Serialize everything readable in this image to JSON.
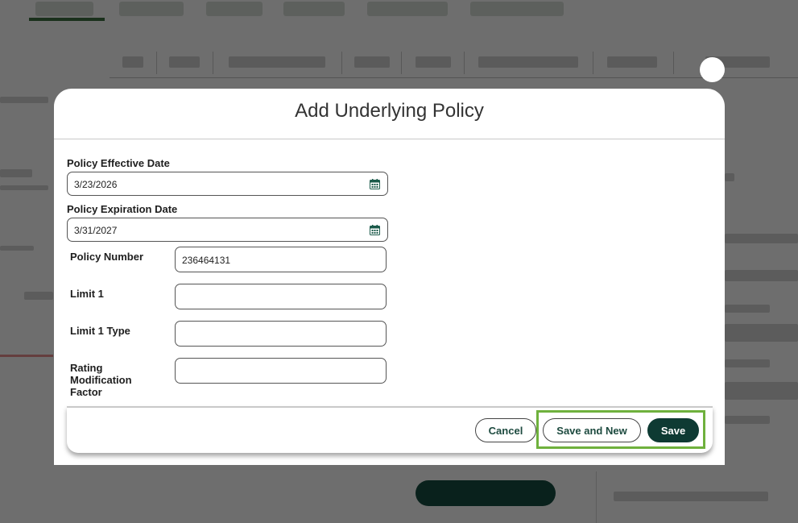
{
  "modal": {
    "title": "Add Underlying Policy",
    "fields": {
      "effective_date": {
        "label": "Policy Effective Date",
        "value": "3/23/2026"
      },
      "expiration_date": {
        "label": "Policy Expiration Date",
        "value": "3/31/2027"
      },
      "policy_number": {
        "label": "Policy Number",
        "value": "236464131"
      },
      "limit1": {
        "label": "Limit 1",
        "value": ""
      },
      "limit1_type": {
        "label": "Limit 1 Type",
        "value": ""
      },
      "rating_factor": {
        "label_lines": [
          "Rating",
          "Modification",
          "Factor"
        ],
        "value": ""
      }
    },
    "footer": {
      "cancel_label": "Cancel",
      "save_new_label": "Save and New",
      "save_label": "Save"
    }
  },
  "icons": {
    "calendar": "calendar-icon"
  },
  "colors": {
    "primary_dark": "#0e3a33",
    "highlight": "#6fb13d",
    "overlay": "rgba(0,0,0,0.55)"
  }
}
